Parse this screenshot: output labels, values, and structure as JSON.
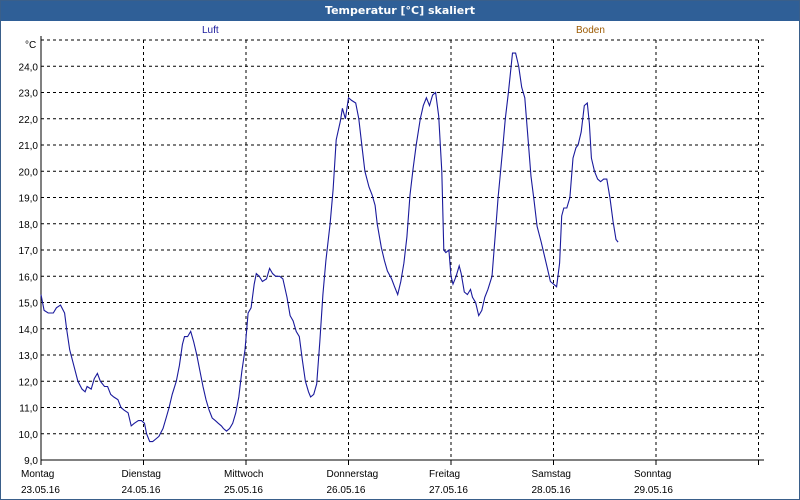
{
  "window": {
    "title": "Temperatur [°C] skaliert"
  },
  "legend": [
    {
      "name": "Luft",
      "color": "#1a1a9c"
    },
    {
      "name": "Boden",
      "color": "#9c5a00"
    }
  ],
  "chart_data": {
    "type": "line",
    "title": "Temperatur [°C] skaliert",
    "ylabel": "°C",
    "xlabel": "",
    "ylim": [
      9.0,
      25.0
    ],
    "yticks": [
      "9,0",
      "10,0",
      "11,0",
      "12,0",
      "13,0",
      "14,0",
      "15,0",
      "16,0",
      "17,0",
      "18,0",
      "19,0",
      "20,0",
      "21,0",
      "22,0",
      "23,0",
      "24,0"
    ],
    "xlim": [
      0,
      7
    ],
    "x_unit": "days from Montag 23.05.16",
    "day_labels": [
      {
        "day": "Montag",
        "date": "23.05.16"
      },
      {
        "day": "Dienstag",
        "date": "24.05.16"
      },
      {
        "day": "Mittwoch",
        "date": "25.05.16"
      },
      {
        "day": "Donnerstag",
        "date": "26.05.16"
      },
      {
        "day": "Freitag",
        "date": "27.05.16"
      },
      {
        "day": "Samstag",
        "date": "28.05.16"
      },
      {
        "day": "Sonntag",
        "date": "29.05.16"
      }
    ],
    "grid": true,
    "legend_position": "top",
    "series": [
      {
        "name": "Luft",
        "color": "#1a1a9c",
        "points": [
          [
            0.0,
            15.3
          ],
          [
            0.03,
            14.7
          ],
          [
            0.07,
            14.6
          ],
          [
            0.12,
            14.6
          ],
          [
            0.15,
            14.8
          ],
          [
            0.19,
            14.9
          ],
          [
            0.23,
            14.6
          ],
          [
            0.25,
            14.0
          ],
          [
            0.28,
            13.2
          ],
          [
            0.32,
            12.6
          ],
          [
            0.36,
            12.0
          ],
          [
            0.4,
            11.7
          ],
          [
            0.43,
            11.6
          ],
          [
            0.45,
            11.8
          ],
          [
            0.49,
            11.7
          ],
          [
            0.52,
            12.1
          ],
          [
            0.55,
            12.3
          ],
          [
            0.58,
            12.0
          ],
          [
            0.62,
            11.8
          ],
          [
            0.65,
            11.8
          ],
          [
            0.68,
            11.5
          ],
          [
            0.71,
            11.4
          ],
          [
            0.75,
            11.3
          ],
          [
            0.78,
            11.0
          ],
          [
            0.81,
            10.9
          ],
          [
            0.85,
            10.8
          ],
          [
            0.88,
            10.3
          ],
          [
            0.91,
            10.4
          ],
          [
            0.95,
            10.5
          ],
          [
            0.98,
            10.5
          ],
          [
            1.01,
            10.4
          ],
          [
            1.03,
            10.0
          ],
          [
            1.06,
            9.7
          ],
          [
            1.09,
            9.7
          ],
          [
            1.12,
            9.8
          ],
          [
            1.15,
            9.9
          ],
          [
            1.19,
            10.2
          ],
          [
            1.22,
            10.6
          ],
          [
            1.25,
            11.0
          ],
          [
            1.28,
            11.5
          ],
          [
            1.32,
            12.0
          ],
          [
            1.35,
            12.6
          ],
          [
            1.38,
            13.4
          ],
          [
            1.4,
            13.7
          ],
          [
            1.43,
            13.7
          ],
          [
            1.46,
            13.9
          ],
          [
            1.49,
            13.5
          ],
          [
            1.52,
            13.0
          ],
          [
            1.55,
            12.4
          ],
          [
            1.58,
            11.8
          ],
          [
            1.61,
            11.3
          ],
          [
            1.64,
            10.9
          ],
          [
            1.67,
            10.6
          ],
          [
            1.7,
            10.5
          ],
          [
            1.73,
            10.4
          ],
          [
            1.76,
            10.3
          ],
          [
            1.78,
            10.2
          ],
          [
            1.81,
            10.1
          ],
          [
            1.84,
            10.2
          ],
          [
            1.87,
            10.4
          ],
          [
            1.9,
            10.8
          ],
          [
            1.93,
            11.4
          ],
          [
            1.96,
            12.4
          ],
          [
            1.99,
            13.2
          ],
          [
            2.02,
            14.6
          ],
          [
            2.05,
            14.8
          ],
          [
            2.08,
            15.7
          ],
          [
            2.1,
            16.1
          ],
          [
            2.13,
            16.0
          ],
          [
            2.16,
            15.8
          ],
          [
            2.2,
            15.9
          ],
          [
            2.23,
            16.3
          ],
          [
            2.26,
            16.1
          ],
          [
            2.29,
            16.0
          ],
          [
            2.33,
            16.0
          ],
          [
            2.36,
            15.9
          ],
          [
            2.4,
            15.2
          ],
          [
            2.43,
            14.5
          ],
          [
            2.46,
            14.3
          ],
          [
            2.49,
            13.9
          ],
          [
            2.52,
            13.7
          ],
          [
            2.55,
            12.8
          ],
          [
            2.58,
            12.0
          ],
          [
            2.61,
            11.6
          ],
          [
            2.63,
            11.4
          ],
          [
            2.66,
            11.5
          ],
          [
            2.69,
            11.9
          ],
          [
            2.72,
            13.5
          ],
          [
            2.75,
            15.3
          ],
          [
            2.78,
            16.6
          ],
          [
            2.82,
            18.0
          ],
          [
            2.85,
            19.3
          ],
          [
            2.88,
            21.2
          ],
          [
            2.92,
            21.9
          ],
          [
            2.94,
            22.4
          ],
          [
            2.97,
            22.0
          ],
          [
            3.0,
            22.8
          ],
          [
            3.03,
            22.7
          ],
          [
            3.07,
            22.6
          ],
          [
            3.1,
            22.0
          ],
          [
            3.13,
            21.0
          ],
          [
            3.16,
            20.0
          ],
          [
            3.2,
            19.4
          ],
          [
            3.23,
            19.1
          ],
          [
            3.26,
            18.7
          ],
          [
            3.28,
            18.0
          ],
          [
            3.32,
            17.1
          ],
          [
            3.35,
            16.6
          ],
          [
            3.38,
            16.2
          ],
          [
            3.42,
            15.9
          ],
          [
            3.45,
            15.6
          ],
          [
            3.48,
            15.3
          ],
          [
            3.51,
            15.8
          ],
          [
            3.54,
            16.5
          ],
          [
            3.57,
            17.5
          ],
          [
            3.6,
            19.1
          ],
          [
            3.63,
            20.1
          ],
          [
            3.66,
            21.0
          ],
          [
            3.7,
            22.0
          ],
          [
            3.73,
            22.5
          ],
          [
            3.76,
            22.8
          ],
          [
            3.79,
            22.5
          ],
          [
            3.82,
            22.9
          ],
          [
            3.85,
            23.0
          ],
          [
            3.88,
            22.1
          ],
          [
            3.91,
            20.0
          ],
          [
            3.93,
            17.0
          ],
          [
            3.95,
            16.9
          ],
          [
            3.98,
            17.0
          ],
          [
            4.0,
            16.0
          ],
          [
            4.02,
            15.7
          ],
          [
            4.05,
            16.0
          ],
          [
            4.08,
            16.4
          ],
          [
            4.1,
            16.1
          ],
          [
            4.13,
            15.4
          ],
          [
            4.16,
            15.3
          ],
          [
            4.19,
            15.5
          ],
          [
            4.21,
            15.2
          ],
          [
            4.24,
            15.0
          ],
          [
            4.27,
            14.5
          ],
          [
            4.3,
            14.7
          ],
          [
            4.33,
            15.2
          ],
          [
            4.36,
            15.5
          ],
          [
            4.4,
            16.0
          ],
          [
            4.43,
            17.5
          ],
          [
            4.46,
            19.0
          ],
          [
            4.5,
            20.7
          ],
          [
            4.53,
            22.0
          ],
          [
            4.56,
            23.0
          ],
          [
            4.6,
            24.5
          ],
          [
            4.63,
            24.5
          ],
          [
            4.66,
            24.0
          ],
          [
            4.69,
            23.2
          ],
          [
            4.72,
            22.8
          ],
          [
            4.75,
            21.3
          ],
          [
            4.78,
            19.8
          ],
          [
            4.81,
            18.9
          ],
          [
            4.84,
            17.9
          ],
          [
            4.88,
            17.3
          ],
          [
            4.91,
            16.8
          ],
          [
            4.94,
            16.3
          ],
          [
            4.97,
            15.8
          ],
          [
            5.0,
            15.7
          ],
          [
            5.03,
            15.6
          ],
          [
            5.06,
            16.5
          ],
          [
            5.08,
            18.3
          ],
          [
            5.1,
            18.6
          ],
          [
            5.13,
            18.6
          ],
          [
            5.16,
            19.0
          ],
          [
            5.19,
            20.5
          ],
          [
            5.22,
            20.9
          ],
          [
            5.24,
            21.0
          ],
          [
            5.27,
            21.5
          ],
          [
            5.3,
            22.5
          ],
          [
            5.33,
            22.6
          ],
          [
            5.35,
            21.8
          ],
          [
            5.37,
            20.5
          ],
          [
            5.4,
            20.0
          ],
          [
            5.43,
            19.7
          ],
          [
            5.46,
            19.6
          ],
          [
            5.49,
            19.7
          ],
          [
            5.52,
            19.7
          ],
          [
            5.55,
            19.0
          ],
          [
            5.58,
            18.1
          ],
          [
            5.61,
            17.4
          ],
          [
            5.63,
            17.3
          ]
        ]
      }
    ]
  }
}
